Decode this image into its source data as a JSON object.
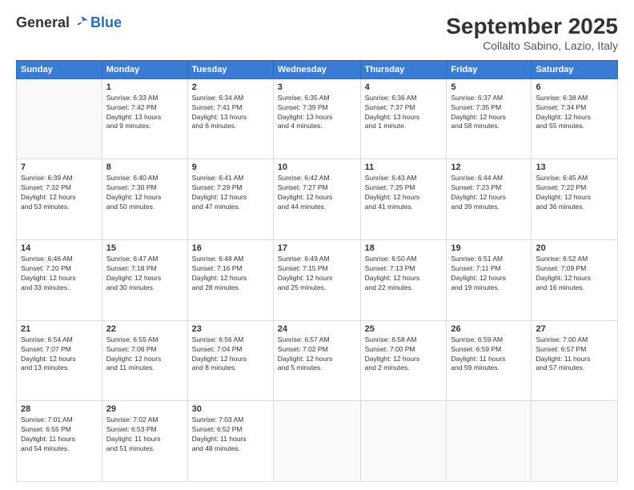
{
  "logo": {
    "general": "General",
    "blue": "Blue"
  },
  "header": {
    "month": "September 2025",
    "location": "Collalto Sabino, Lazio, Italy"
  },
  "weekdays": [
    "Sunday",
    "Monday",
    "Tuesday",
    "Wednesday",
    "Thursday",
    "Friday",
    "Saturday"
  ],
  "weeks": [
    [
      {
        "day": "",
        "info": ""
      },
      {
        "day": "1",
        "info": "Sunrise: 6:33 AM\nSunset: 7:42 PM\nDaylight: 13 hours\nand 9 minutes."
      },
      {
        "day": "2",
        "info": "Sunrise: 6:34 AM\nSunset: 7:41 PM\nDaylight: 13 hours\nand 6 minutes."
      },
      {
        "day": "3",
        "info": "Sunrise: 6:35 AM\nSunset: 7:39 PM\nDaylight: 13 hours\nand 4 minutes."
      },
      {
        "day": "4",
        "info": "Sunrise: 6:36 AM\nSunset: 7:37 PM\nDaylight: 13 hours\nand 1 minute."
      },
      {
        "day": "5",
        "info": "Sunrise: 6:37 AM\nSunset: 7:35 PM\nDaylight: 12 hours\nand 58 minutes."
      },
      {
        "day": "6",
        "info": "Sunrise: 6:38 AM\nSunset: 7:34 PM\nDaylight: 12 hours\nand 55 minutes."
      }
    ],
    [
      {
        "day": "7",
        "info": "Sunrise: 6:39 AM\nSunset: 7:32 PM\nDaylight: 12 hours\nand 53 minutes."
      },
      {
        "day": "8",
        "info": "Sunrise: 6:40 AM\nSunset: 7:30 PM\nDaylight: 12 hours\nand 50 minutes."
      },
      {
        "day": "9",
        "info": "Sunrise: 6:41 AM\nSunset: 7:29 PM\nDaylight: 12 hours\nand 47 minutes."
      },
      {
        "day": "10",
        "info": "Sunrise: 6:42 AM\nSunset: 7:27 PM\nDaylight: 12 hours\nand 44 minutes."
      },
      {
        "day": "11",
        "info": "Sunrise: 6:43 AM\nSunset: 7:25 PM\nDaylight: 12 hours\nand 41 minutes."
      },
      {
        "day": "12",
        "info": "Sunrise: 6:44 AM\nSunset: 7:23 PM\nDaylight: 12 hours\nand 39 minutes."
      },
      {
        "day": "13",
        "info": "Sunrise: 6:45 AM\nSunset: 7:22 PM\nDaylight: 12 hours\nand 36 minutes."
      }
    ],
    [
      {
        "day": "14",
        "info": "Sunrise: 6:46 AM\nSunset: 7:20 PM\nDaylight: 12 hours\nand 33 minutes."
      },
      {
        "day": "15",
        "info": "Sunrise: 6:47 AM\nSunset: 7:18 PM\nDaylight: 12 hours\nand 30 minutes."
      },
      {
        "day": "16",
        "info": "Sunrise: 6:48 AM\nSunset: 7:16 PM\nDaylight: 12 hours\nand 28 minutes."
      },
      {
        "day": "17",
        "info": "Sunrise: 6:49 AM\nSunset: 7:15 PM\nDaylight: 12 hours\nand 25 minutes."
      },
      {
        "day": "18",
        "info": "Sunrise: 6:50 AM\nSunset: 7:13 PM\nDaylight: 12 hours\nand 22 minutes."
      },
      {
        "day": "19",
        "info": "Sunrise: 6:51 AM\nSunset: 7:11 PM\nDaylight: 12 hours\nand 19 minutes."
      },
      {
        "day": "20",
        "info": "Sunrise: 6:52 AM\nSunset: 7:09 PM\nDaylight: 12 hours\nand 16 minutes."
      }
    ],
    [
      {
        "day": "21",
        "info": "Sunrise: 6:54 AM\nSunset: 7:07 PM\nDaylight: 12 hours\nand 13 minutes."
      },
      {
        "day": "22",
        "info": "Sunrise: 6:55 AM\nSunset: 7:06 PM\nDaylight: 12 hours\nand 11 minutes."
      },
      {
        "day": "23",
        "info": "Sunrise: 6:56 AM\nSunset: 7:04 PM\nDaylight: 12 hours\nand 8 minutes."
      },
      {
        "day": "24",
        "info": "Sunrise: 6:57 AM\nSunset: 7:02 PM\nDaylight: 12 hours\nand 5 minutes."
      },
      {
        "day": "25",
        "info": "Sunrise: 6:58 AM\nSunset: 7:00 PM\nDaylight: 12 hours\nand 2 minutes."
      },
      {
        "day": "26",
        "info": "Sunrise: 6:59 AM\nSunset: 6:59 PM\nDaylight: 11 hours\nand 59 minutes."
      },
      {
        "day": "27",
        "info": "Sunrise: 7:00 AM\nSunset: 6:57 PM\nDaylight: 11 hours\nand 57 minutes."
      }
    ],
    [
      {
        "day": "28",
        "info": "Sunrise: 7:01 AM\nSunset: 6:55 PM\nDaylight: 11 hours\nand 54 minutes."
      },
      {
        "day": "29",
        "info": "Sunrise: 7:02 AM\nSunset: 6:53 PM\nDaylight: 11 hours\nand 51 minutes."
      },
      {
        "day": "30",
        "info": "Sunrise: 7:03 AM\nSunset: 6:52 PM\nDaylight: 11 hours\nand 48 minutes."
      },
      {
        "day": "",
        "info": ""
      },
      {
        "day": "",
        "info": ""
      },
      {
        "day": "",
        "info": ""
      },
      {
        "day": "",
        "info": ""
      }
    ]
  ]
}
